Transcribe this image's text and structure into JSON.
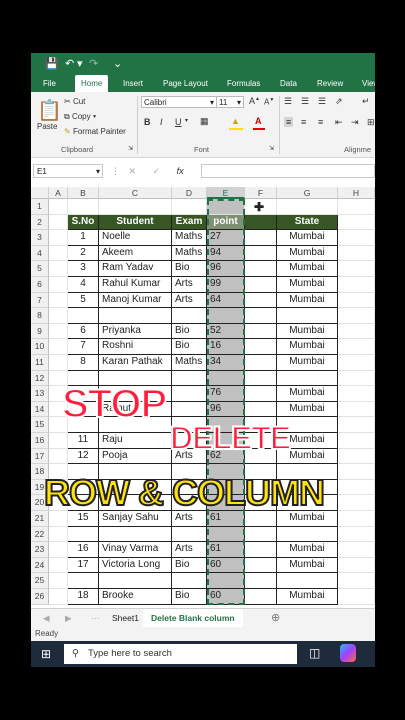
{
  "titlebar": {
    "save_icon": "save-icon",
    "undo_icon": "undo-icon",
    "redo_icon": "redo-icon",
    "more_icon": "dropdown-icon"
  },
  "tabs": [
    "File",
    "Home",
    "Insert",
    "Page Layout",
    "Formulas",
    "Data",
    "Review",
    "View"
  ],
  "active_tab": "Home",
  "clipboard": {
    "paste": "Paste",
    "cut": "Cut",
    "copy": "Copy",
    "format_painter": "Format Painter",
    "label": "Clipboard"
  },
  "font": {
    "name": "Calibri",
    "size": "11",
    "bold": "B",
    "italic": "I",
    "underline": "U",
    "grow": "A",
    "shrink": "A",
    "label": "Font"
  },
  "alignment": {
    "label": "Alignme"
  },
  "formula_bar": {
    "name_box": "E1",
    "cancel": "✕",
    "enter": "✓",
    "fx": "fx",
    "value": ""
  },
  "columns": [
    "A",
    "B",
    "C",
    "D",
    "E",
    "F",
    "G",
    "H"
  ],
  "rows": [
    "1",
    "2",
    "3",
    "4",
    "5",
    "6",
    "7",
    "8",
    "9",
    "10",
    "11",
    "12",
    "13",
    "14",
    "15",
    "16",
    "17",
    "18",
    "19",
    "20",
    "21",
    "22",
    "23",
    "24",
    "25",
    "26"
  ],
  "table": {
    "headers": [
      "S.No",
      "Student",
      "Exam",
      "point",
      "",
      "State"
    ],
    "data": [
      [
        "1",
        "Noelle",
        "Maths",
        "27",
        "",
        "Mumbai"
      ],
      [
        "2",
        "Akeem",
        "Maths",
        "94",
        "",
        "Mumbai"
      ],
      [
        "3",
        "Ram Yadav",
        "Bio",
        "96",
        "",
        "Mumbai"
      ],
      [
        "4",
        "Rahul Kumar",
        "Arts",
        "99",
        "",
        "Mumbai"
      ],
      [
        "5",
        "Manoj Kumar",
        "Arts",
        "64",
        "",
        "Mumbai"
      ],
      [
        "",
        "",
        "",
        "",
        "",
        ""
      ],
      [
        "6",
        "Priyanka",
        "Bio",
        "52",
        "",
        "Mumbai"
      ],
      [
        "7",
        "Roshni",
        "Bio",
        "16",
        "",
        "Mumbai"
      ],
      [
        "8",
        "Karan Pathak",
        "Maths",
        "34",
        "",
        "Mumbai"
      ],
      [
        "",
        "",
        "",
        "",
        "",
        ""
      ],
      [
        "",
        "",
        "",
        "76",
        "",
        "Mumbai"
      ],
      [
        "",
        "Rajput",
        "",
        "96",
        "",
        "Mumbai"
      ],
      [
        "",
        "",
        "",
        "",
        "",
        ""
      ],
      [
        "11",
        "Raju",
        "",
        "",
        "",
        "Mumbai"
      ],
      [
        "12",
        "Pooja",
        "Arts",
        "62",
        "",
        "Mumbai"
      ],
      [
        "",
        "",
        "",
        "",
        "",
        ""
      ],
      [
        "",
        "",
        "",
        "",
        "",
        ""
      ],
      [
        "",
        "",
        "",
        "",
        "",
        ""
      ],
      [
        "15",
        "Sanjay Sahu",
        "Arts",
        "61",
        "",
        "Mumbai"
      ],
      [
        "",
        "",
        "",
        "",
        "",
        ""
      ],
      [
        "16",
        "Vinay Varma",
        "Arts",
        "61",
        "",
        "Mumbai"
      ],
      [
        "17",
        "Victoria Long",
        "Bio",
        "60",
        "",
        "Mumbai"
      ],
      [
        "",
        "",
        "",
        "",
        "",
        ""
      ],
      [
        "18",
        "Brooke",
        "Bio",
        "60",
        "",
        "Mumbai"
      ]
    ]
  },
  "overlay": {
    "line1": "STOP",
    "line2": "DELETE",
    "line3": "ROW & COLUMN"
  },
  "sheet_tabs": [
    "Sheet1",
    "Delete  Blank column"
  ],
  "active_sheet": "Delete  Blank column",
  "status": "Ready",
  "taskbar": {
    "search_placeholder": "Type here to search"
  },
  "colors": {
    "excel_green": "#217346",
    "header_fill": "#375623",
    "stop_red": "#ff1f3d",
    "row_col_yellow": "#ffe30c"
  }
}
